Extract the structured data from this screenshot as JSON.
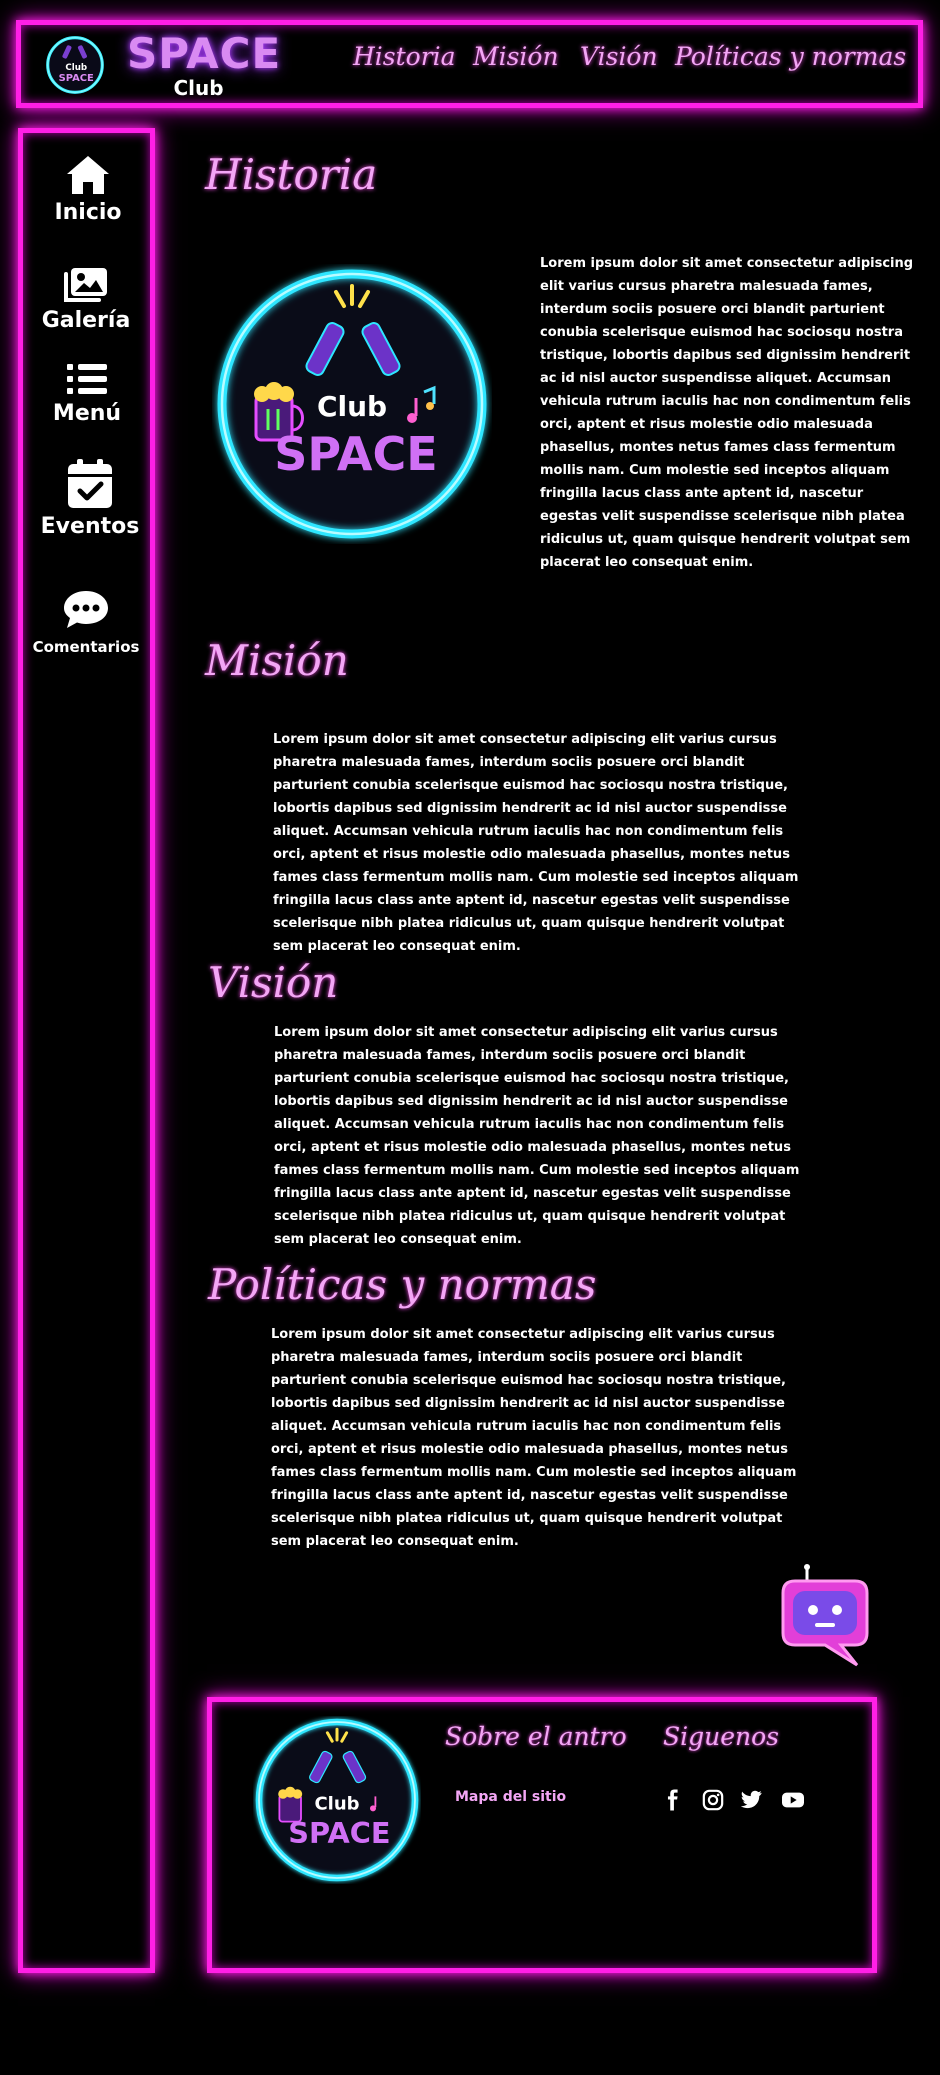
{
  "header": {
    "brand_main": "SPACE",
    "brand_sub": "Club",
    "nav": [
      "Historia",
      "Misión",
      "Visión",
      "Políticas y normas"
    ]
  },
  "logo": {
    "club": "Club",
    "space": "SPACE"
  },
  "sidebar": {
    "items": [
      {
        "label": "Inicio",
        "icon": "home-icon"
      },
      {
        "label": "Galería",
        "icon": "images-icon"
      },
      {
        "label": "Menú",
        "icon": "list-icon"
      },
      {
        "label": "Eventos",
        "icon": "calendar-check-icon"
      },
      {
        "label": "Comentarios",
        "icon": "chat-icon"
      }
    ]
  },
  "sections": {
    "historia": {
      "title": "Historia",
      "text": "Lorem ipsum dolor sit amet consectetur adipiscing elit varius cursus pharetra malesuada fames, interdum sociis posuere orci blandit parturient conubia scelerisque euismod hac sociosqu nostra tristique, lobortis dapibus sed dignissim hendrerit ac id nisl auctor suspendisse aliquet. Accumsan vehicula rutrum iaculis hac non condimentum felis orci, aptent et risus molestie odio malesuada phasellus, montes netus fames class fermentum mollis nam. Cum molestie sed inceptos aliquam fringilla lacus class ante aptent id, nascetur egestas velit suspendisse scelerisque nibh platea ridiculus ut, quam quisque hendrerit volutpat sem placerat leo consequat enim."
    },
    "mision": {
      "title": "Misión",
      "text": "Lorem ipsum dolor sit amet consectetur adipiscing elit varius cursus pharetra malesuada fames, interdum sociis posuere orci blandit parturient conubia scelerisque euismod hac sociosqu nostra tristique, lobortis dapibus sed dignissim hendrerit ac id nisl auctor suspendisse aliquet. Accumsan vehicula rutrum iaculis hac non condimentum felis orci, aptent et risus molestie odio malesuada phasellus, montes netus fames class fermentum mollis nam. Cum molestie sed inceptos aliquam fringilla lacus class ante aptent id, nascetur egestas velit suspendisse scelerisque nibh platea ridiculus ut, quam quisque hendrerit volutpat sem placerat leo consequat enim."
    },
    "vision": {
      "title": "Visión",
      "text": "Lorem ipsum dolor sit amet consectetur adipiscing elit varius cursus pharetra malesuada fames, interdum sociis posuere orci blandit parturient conubia scelerisque euismod hac sociosqu nostra tristique, lobortis dapibus sed dignissim hendrerit ac id nisl auctor suspendisse aliquet. Accumsan vehicula rutrum iaculis hac non condimentum felis orci, aptent et risus molestie odio malesuada phasellus, montes netus fames class fermentum mollis nam. Cum molestie sed inceptos aliquam fringilla lacus class ante aptent id, nascetur egestas velit suspendisse scelerisque nibh platea ridiculus ut, quam quisque hendrerit volutpat sem placerat leo consequat enim."
    },
    "politicas": {
      "title": "Políticas y normas",
      "text": "Lorem ipsum dolor sit amet consectetur adipiscing elit varius cursus pharetra malesuada fames, interdum sociis posuere orci blandit parturient conubia scelerisque euismod hac sociosqu nostra tristique, lobortis dapibus sed dignissim hendrerit ac id nisl auctor suspendisse aliquet. Accumsan vehicula rutrum iaculis hac non condimentum felis orci, aptent et risus molestie odio malesuada phasellus, montes netus fames class fermentum mollis nam. Cum molestie sed inceptos aliquam fringilla lacus class ante aptent id, nascetur egestas velit suspendisse scelerisque nibh platea ridiculus ut, quam quisque hendrerit volutpat sem placerat leo consequat enim."
    }
  },
  "footer": {
    "about_title": "Sobre el antro",
    "follow_title": "Siguenos",
    "sitemap_link": "Mapa del sitio",
    "social_icons": [
      "facebook-icon",
      "instagram-icon",
      "twitter-icon",
      "youtube-icon"
    ]
  },
  "colors": {
    "neon_pink": "#ff1fe6",
    "heading_pink": "#f3a6f5",
    "ring_cyan": "#3ff0ff",
    "brand_purple": "#d98af2",
    "background": "#000000"
  }
}
